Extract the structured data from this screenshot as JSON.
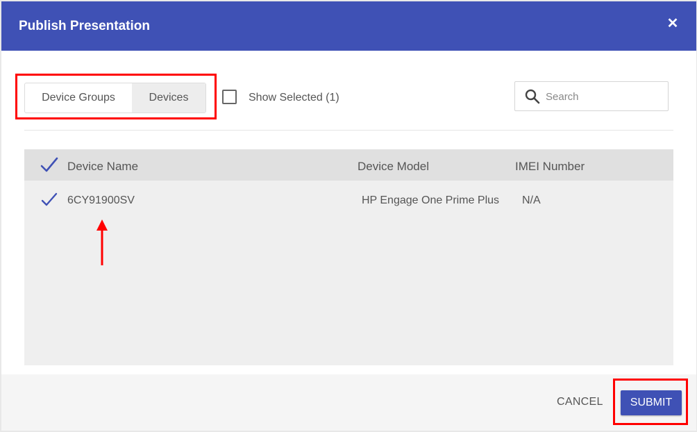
{
  "dialog": {
    "title": "Publish Presentation",
    "close_icon": "close-icon"
  },
  "toggle": {
    "options": [
      "Device Groups",
      "Devices"
    ],
    "selected": "Devices"
  },
  "show_selected": {
    "label": "Show Selected (1)",
    "checked": false
  },
  "search": {
    "placeholder": "Search",
    "value": ""
  },
  "table": {
    "columns": [
      "Device Name",
      "Device Model",
      "IMEI Number"
    ],
    "header_checked": true,
    "rows": [
      {
        "checked": true,
        "device_name": "6CY91900SV",
        "device_model": "HP Engage One Prime Plus",
        "imei": "N/A"
      }
    ]
  },
  "footer": {
    "cancel_label": "CANCEL",
    "submit_label": "SUBMIT"
  },
  "colors": {
    "primary": "#3f51b5",
    "annotation": "#ff0000"
  }
}
